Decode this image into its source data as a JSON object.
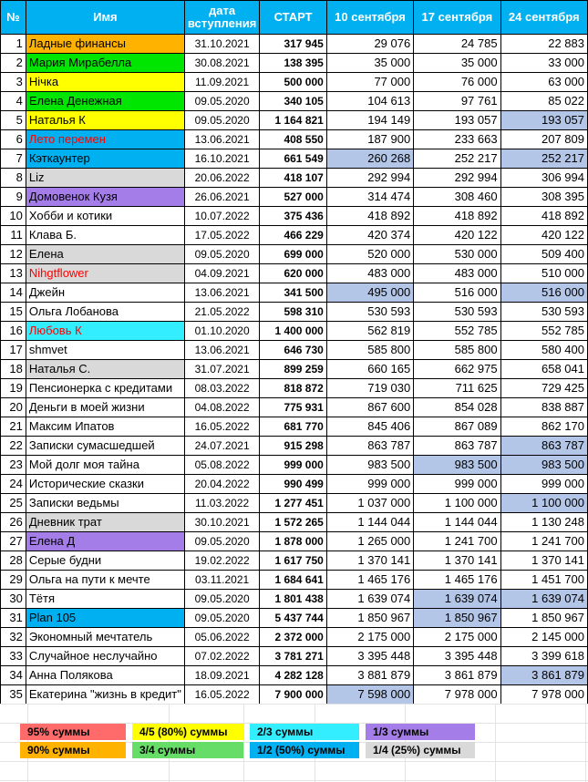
{
  "headers": {
    "num": "№",
    "name": "Имя",
    "joined_line1": "дата",
    "joined_line2": "вступления",
    "start": "СТАРТ",
    "d1": "10 сентября",
    "d2": "17 сентября",
    "d3": "24 сентября"
  },
  "colors": {
    "header": "#00b0f0",
    "highlight_cell": "#b4c6e7",
    "red": "#ff6b6b",
    "orange": "#ffb300",
    "yellow": "#ffff00",
    "green": "#00e600",
    "lightgreen": "#66dd66",
    "cyan": "#33eeff",
    "blue": "#00b0f0",
    "purple": "#a57de8",
    "gray": "#d9d9d9"
  },
  "rows": [
    {
      "n": "1",
      "name": "Ладные финансы",
      "date": "31.10.2021",
      "start": "317 945",
      "d1": "29 076",
      "d2": "24 785",
      "d3": "22 883",
      "bg": "#ffb300",
      "fg": "#000",
      "hl": []
    },
    {
      "n": "2",
      "name": "Мария Мирабелла",
      "date": "30.08.2021",
      "start": "138 395",
      "d1": "35 000",
      "d2": "35 000",
      "d3": "33 000",
      "bg": "#00e600",
      "fg": "#000",
      "hl": []
    },
    {
      "n": "3",
      "name": "Нічка",
      "date": "11.09.2021",
      "start": "500 000",
      "d1": "77 000",
      "d2": "76 000",
      "d3": "63 000",
      "bg": "#ffff00",
      "fg": "#000",
      "hl": []
    },
    {
      "n": "4",
      "name": "Елена Денежная",
      "date": "09.05.2020",
      "start": "340 105",
      "d1": "104 613",
      "d2": "97 761",
      "d3": "85 022",
      "bg": "#00e600",
      "fg": "#000",
      "hl": []
    },
    {
      "n": "5",
      "name": "Наталья К",
      "date": "09.05.2020",
      "start": "1 164 821",
      "d1": "194 149",
      "d2": "193 057",
      "d3": "193 057",
      "bg": "#ffff00",
      "fg": "#000",
      "hl": [
        "d3"
      ]
    },
    {
      "n": "6",
      "name": "Лето перемен",
      "date": "13.06.2021",
      "start": "408 550",
      "d1": "187 900",
      "d2": "233 663",
      "d3": "207 809",
      "bg": "#00b0f0",
      "fg": "#ff0000",
      "hl": []
    },
    {
      "n": "7",
      "name": "Кэткаунтер",
      "date": "16.10.2021",
      "start": "661 549",
      "d1": "260 268",
      "d2": "252 217",
      "d3": "252 217",
      "bg": "#00b0f0",
      "fg": "#000",
      "hl": [
        "d1",
        "d3"
      ]
    },
    {
      "n": "8",
      "name": "Liz",
      "date": "20.06.2022",
      "start": "418 107",
      "d1": "292 994",
      "d2": "292 994",
      "d3": "306 994",
      "bg": "#d9d9d9",
      "fg": "#000",
      "hl": []
    },
    {
      "n": "9",
      "name": "Домовенок Кузя",
      "date": "26.06.2021",
      "start": "527 000",
      "d1": "314 474",
      "d2": "308 460",
      "d3": "308 395",
      "bg": "#a57de8",
      "fg": "#000",
      "hl": []
    },
    {
      "n": "10",
      "name": "Хобби и котики",
      "date": "10.07.2022",
      "start": "375 436",
      "d1": "418 892",
      "d2": "418 892",
      "d3": "418 892",
      "bg": "#ffffff",
      "fg": "#000",
      "hl": []
    },
    {
      "n": "11",
      "name": "Клава Б.",
      "date": "17.05.2022",
      "start": "466 229",
      "d1": "420 374",
      "d2": "420 122",
      "d3": "420 122",
      "bg": "#ffffff",
      "fg": "#000",
      "hl": []
    },
    {
      "n": "12",
      "name": "Елена",
      "date": "09.05.2020",
      "start": "699 000",
      "d1": "520 000",
      "d2": "530 000",
      "d3": "509 400",
      "bg": "#d9d9d9",
      "fg": "#000",
      "hl": []
    },
    {
      "n": "13",
      "name": "Nihgtflower",
      "date": "04.09.2021",
      "start": "620 000",
      "d1": "483 000",
      "d2": "483 000",
      "d3": "510 000",
      "bg": "#d9d9d9",
      "fg": "#ff0000",
      "hl": []
    },
    {
      "n": "14",
      "name": "Джейн",
      "date": "13.06.2021",
      "start": "341 500",
      "d1": "495 000",
      "d2": "516 000",
      "d3": "516 000",
      "bg": "#ffffff",
      "fg": "#000",
      "hl": [
        "d1",
        "d3"
      ]
    },
    {
      "n": "15",
      "name": "Ольга Лобанова",
      "date": "21.05.2022",
      "start": "598 310",
      "d1": "530 593",
      "d2": "530 593",
      "d3": "530 593",
      "bg": "#ffffff",
      "fg": "#000",
      "hl": []
    },
    {
      "n": "16",
      "name": "Любовь К",
      "date": "01.10.2020",
      "start": "1 400 000",
      "d1": "562 819",
      "d2": "552 785",
      "d3": "552 785",
      "bg": "#33eeff",
      "fg": "#ff0000",
      "hl": []
    },
    {
      "n": "17",
      "name": "shmvet",
      "date": "13.06.2021",
      "start": "646 730",
      "d1": "585 800",
      "d2": "585 800",
      "d3": "580 400",
      "bg": "#ffffff",
      "fg": "#000",
      "hl": []
    },
    {
      "n": "18",
      "name": "Наталья С.",
      "date": "31.07.2021",
      "start": "899 259",
      "d1": "660 165",
      "d2": "662 975",
      "d3": "658 041",
      "bg": "#d9d9d9",
      "fg": "#000",
      "hl": []
    },
    {
      "n": "19",
      "name": "Пенсионерка с кредитами",
      "date": "08.03.2022",
      "start": "818 872",
      "d1": "719 030",
      "d2": "711 625",
      "d3": "729 425",
      "bg": "#ffffff",
      "fg": "#000",
      "hl": []
    },
    {
      "n": "20",
      "name": "Деньги в моей жизни",
      "date": "04.08.2022",
      "start": "775 931",
      "d1": "867 600",
      "d2": "854 028",
      "d3": "838 887",
      "bg": "#ffffff",
      "fg": "#000",
      "hl": []
    },
    {
      "n": "21",
      "name": "Максим Ипатов",
      "date": "16.05.2022",
      "start": "681 770",
      "d1": "845 406",
      "d2": "867 089",
      "d3": "862 170",
      "bg": "#ffffff",
      "fg": "#000",
      "hl": []
    },
    {
      "n": "22",
      "name": "Записки сумасшедшей",
      "date": "24.07.2021",
      "start": "915 298",
      "d1": "863 787",
      "d2": "863 787",
      "d3": "863 787",
      "bg": "#ffffff",
      "fg": "#000",
      "hl": [
        "d3"
      ]
    },
    {
      "n": "23",
      "name": "Мой долг моя тайна",
      "date": "05.08.2022",
      "start": "999 000",
      "d1": "983 500",
      "d2": "983 500",
      "d3": "983 500",
      "bg": "#ffffff",
      "fg": "#000",
      "hl": [
        "d2",
        "d3"
      ]
    },
    {
      "n": "24",
      "name": "Исторические сказки",
      "date": "20.04.2022",
      "start": "990 499",
      "d1": "999 000",
      "d2": "999 000",
      "d3": "999 000",
      "bg": "#ffffff",
      "fg": "#000",
      "hl": []
    },
    {
      "n": "25",
      "name": "Записки ведьмы",
      "date": "11.03.2022",
      "start": "1 277 451",
      "d1": "1 037 000",
      "d2": "1 100 000",
      "d3": "1 100 000",
      "bg": "#ffffff",
      "fg": "#000",
      "hl": [
        "d3"
      ]
    },
    {
      "n": "26",
      "name": "Дневник трат",
      "date": "30.10.2021",
      "start": "1 572 265",
      "d1": "1 144 044",
      "d2": "1 144 044",
      "d3": "1 130 248",
      "bg": "#d9d9d9",
      "fg": "#000",
      "hl": []
    },
    {
      "n": "27",
      "name": "Елена Д",
      "date": "09.05.2020",
      "start": "1 878 000",
      "d1": "1 265 000",
      "d2": "1 241 700",
      "d3": "1 241 700",
      "bg": "#a57de8",
      "fg": "#000",
      "hl": []
    },
    {
      "n": "28",
      "name": "Серые будни",
      "date": "19.02.2022",
      "start": "1 617 750",
      "d1": "1 370 141",
      "d2": "1 370 141",
      "d3": "1 370 141",
      "bg": "#ffffff",
      "fg": "#000",
      "hl": []
    },
    {
      "n": "29",
      "name": "Ольга на пути к мечте",
      "date": "03.11.2021",
      "start": "1 684 641",
      "d1": "1 465 176",
      "d2": "1 465 176",
      "d3": "1 451 700",
      "bg": "#ffffff",
      "fg": "#000",
      "hl": []
    },
    {
      "n": "30",
      "name": "Тётя",
      "date": "09.05.2020",
      "start": "1 801 438",
      "d1": "1 639 074",
      "d2": "1 639 074",
      "d3": "1 639 074",
      "bg": "#ffffff",
      "fg": "#000",
      "hl": [
        "d2",
        "d3"
      ]
    },
    {
      "n": "31",
      "name": "Plan 105",
      "date": "09.05.2020",
      "start": "5 437 744",
      "d1": "1 850 967",
      "d2": "1 850 967",
      "d3": "1 850 967",
      "bg": "#00b0f0",
      "fg": "#000",
      "hl": [
        "d2"
      ]
    },
    {
      "n": "32",
      "name": "Экономный мечтатель",
      "date": "05.06.2022",
      "start": "2 372 000",
      "d1": "2 175 000",
      "d2": "2 175 000",
      "d3": "2 145 000",
      "bg": "#ffffff",
      "fg": "#000",
      "hl": []
    },
    {
      "n": "33",
      "name": "Случайное неслучайно",
      "date": "07.02.2022",
      "start": "3 781 271",
      "d1": "3 395 448",
      "d2": "3 395 448",
      "d3": "3 399 618",
      "bg": "#ffffff",
      "fg": "#000",
      "hl": []
    },
    {
      "n": "34",
      "name": "Анна Полякова",
      "date": "18.09.2021",
      "start": "4 282 128",
      "d1": "3 881 879",
      "d2": "3 861 879",
      "d3": "3 861 879",
      "bg": "#ffffff",
      "fg": "#000",
      "hl": [
        "d3"
      ]
    },
    {
      "n": "35",
      "name": "Екатерина \"жизнь в кредит\"",
      "date": "16.05.2022",
      "start": "7 900 000",
      "d1": "7 598 000",
      "d2": "7 978 000",
      "d3": "7 978 000",
      "bg": "#ffffff",
      "fg": "#000",
      "hl": [
        "d1"
      ]
    }
  ],
  "legend": [
    {
      "label": "95% суммы",
      "bg": "#ff6b6b"
    },
    {
      "label": "4/5 (80%) суммы",
      "bg": "#ffff00"
    },
    {
      "label": "2/3 суммы",
      "bg": "#33eeff"
    },
    {
      "label": "1/3 суммы",
      "bg": "#a57de8"
    },
    {
      "label": "90% суммы",
      "bg": "#ffb300"
    },
    {
      "label": "3/4 суммы",
      "bg": "#66dd66"
    },
    {
      "label": "1/2 (50%) суммы",
      "bg": "#00b0f0"
    },
    {
      "label": "1/4 (25%) суммы",
      "bg": "#d9d9d9"
    }
  ]
}
